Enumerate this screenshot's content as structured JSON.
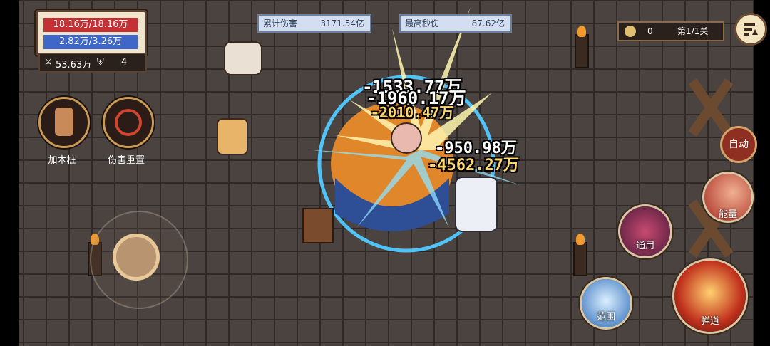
{
  "hud": {
    "hp": "18.16万/18.16万",
    "mp": "2.82万/3.26万",
    "attack": "53.63万",
    "defense": "4"
  },
  "stats": {
    "total_damage_label": "累计伤害",
    "total_damage_value": "3171.54亿",
    "max_dps_label": "最高秒伤",
    "max_dps_value": "87.62亿"
  },
  "top_right": {
    "coins": "0",
    "level": "第1/1关"
  },
  "left_buttons": {
    "add_dummy": "加木桩",
    "reset_damage": "伤害重置"
  },
  "right_controls": {
    "auto": "自动",
    "skill_energy": "能量",
    "skill_general": "通用",
    "skill_range": "范围",
    "skill_projectile": "弹道"
  },
  "damage_numbers": [
    "-1960.17万",
    "-1533.77万",
    "-2010.47万",
    "-950.98万",
    "-4562.27万"
  ],
  "colors": {
    "hp_bar": "#c43134",
    "mp_bar": "#3f67c9",
    "floor": "#4a4340"
  }
}
